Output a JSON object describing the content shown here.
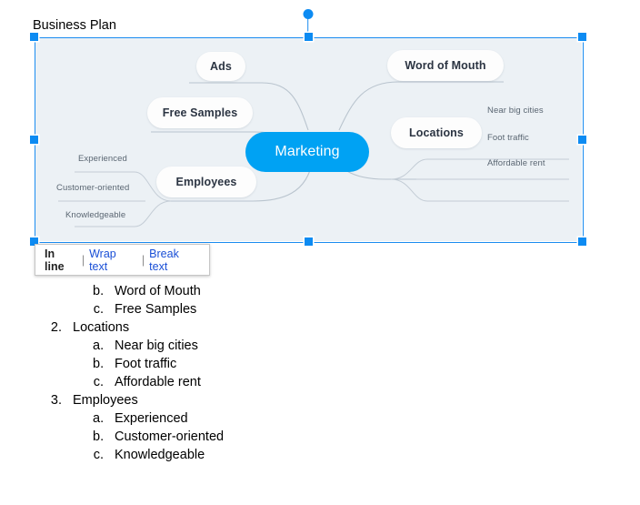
{
  "document": {
    "title": "Business Plan"
  },
  "image_selection": {
    "selected": true,
    "accent_color": "#0d8bf2",
    "handles": [
      "top-left",
      "top-center",
      "top-right",
      "middle-left",
      "middle-right",
      "bottom-left",
      "bottom-center",
      "bottom-right"
    ],
    "rotation_handle": "rotate-handle"
  },
  "mindmap": {
    "background_color": "#ECF1F5",
    "center": {
      "label": "Marketing",
      "color": "#00A2F3",
      "text_color": "#ffffff"
    },
    "branches": [
      {
        "label": "Ads",
        "children": []
      },
      {
        "label": "Word of Mouth",
        "children": []
      },
      {
        "label": "Free Samples",
        "children": []
      },
      {
        "label": "Locations",
        "children": [
          "Near big cities",
          "Foot traffic",
          "Affordable rent"
        ]
      },
      {
        "label": "Employees",
        "children": [
          "Experienced",
          "Customer-oriented",
          "Knowledgeable"
        ]
      }
    ],
    "node_labels": {
      "ads": "Ads",
      "word_of_mouth": "Word of Mouth",
      "free_samples": "Free Samples",
      "locations": "Locations",
      "employees": "Employees",
      "near_big_cities": "Near big cities",
      "foot_traffic": "Foot traffic",
      "affordable_rent": "Affordable rent",
      "experienced": "Experienced",
      "customer_oriented": "Customer-oriented",
      "knowledgeable": "Knowledgeable"
    }
  },
  "text_wrap_popup": {
    "options": [
      {
        "label": "In line",
        "active": true
      },
      {
        "label": "Wrap text",
        "active": false
      },
      {
        "label": "Break text",
        "active": false
      }
    ],
    "separator": "|",
    "link_color": "#1a4fd6"
  },
  "outline": {
    "items": [
      {
        "level": 2,
        "marker": "b.",
        "text": "Word of Mouth"
      },
      {
        "level": 2,
        "marker": "c.",
        "text": "Free Samples"
      },
      {
        "level": 1,
        "marker": "2.",
        "text": "Locations"
      },
      {
        "level": 2,
        "marker": "a.",
        "text": "Near big cities"
      },
      {
        "level": 2,
        "marker": "b.",
        "text": "Foot traffic"
      },
      {
        "level": 2,
        "marker": "c.",
        "text": "Affordable rent"
      },
      {
        "level": 1,
        "marker": "3.",
        "text": "Employees"
      },
      {
        "level": 2,
        "marker": "a.",
        "text": "Experienced"
      },
      {
        "level": 2,
        "marker": "b.",
        "text": "Customer-oriented"
      },
      {
        "level": 2,
        "marker": "c.",
        "text": "Knowledgeable"
      }
    ]
  }
}
